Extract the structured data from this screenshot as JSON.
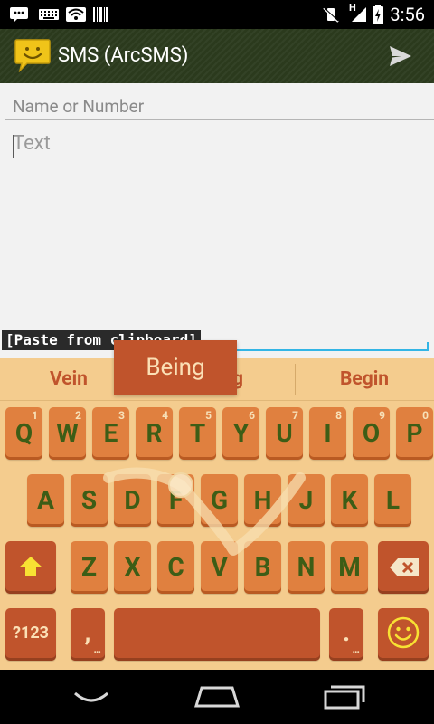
{
  "status_bar": {
    "time": "3:56",
    "left_icons": [
      "chat-notification-icon",
      "keyboard-icon",
      "wifi-icon",
      "barcode-icon"
    ],
    "right_icons": [
      "vibrate-mute-icon",
      "signal-icon",
      "battery-icon"
    ],
    "network_label": "H"
  },
  "action_bar": {
    "title": "SMS (ArcSMS)",
    "send_icon": "send-icon",
    "app_icon": "sms-smiley-icon"
  },
  "compose": {
    "recipient_placeholder": "Name or Number",
    "message_placeholder": "Text",
    "paste_label": "[Paste from clipboard]"
  },
  "keyboard": {
    "suggestions": [
      "Vein",
      "Being",
      "Begin"
    ],
    "suggestion_partial": "g",
    "popup_word": "Being",
    "row1": [
      {
        "key": "Q",
        "num": "1"
      },
      {
        "key": "W",
        "num": "2"
      },
      {
        "key": "E",
        "num": "3"
      },
      {
        "key": "R",
        "num": "4"
      },
      {
        "key": "T",
        "num": "5"
      },
      {
        "key": "Y",
        "num": "6"
      },
      {
        "key": "U",
        "num": "7"
      },
      {
        "key": "I",
        "num": "8"
      },
      {
        "key": "O",
        "num": "9"
      },
      {
        "key": "P",
        "num": "0"
      }
    ],
    "row2": [
      "A",
      "S",
      "D",
      "F",
      "G",
      "H",
      "J",
      "K",
      "L"
    ],
    "row3": [
      "Z",
      "X",
      "C",
      "V",
      "B",
      "N",
      "M"
    ],
    "symbols_label": "?123",
    "comma_label": ",",
    "period_label": ".",
    "more_dots": "...",
    "shift_icon": "shift-arrow-icon",
    "backspace_icon": "backspace-icon",
    "emoji_icon": "smiley-icon",
    "colors": {
      "background": "#f4cc8e",
      "key": "#e0803f",
      "dark_key": "#c0542c",
      "key_text": "#3d5d16",
      "accent": "#33b5e5"
    }
  },
  "nav_bar": {
    "icons": [
      "back-icon",
      "home-icon",
      "recent-apps-icon"
    ]
  }
}
